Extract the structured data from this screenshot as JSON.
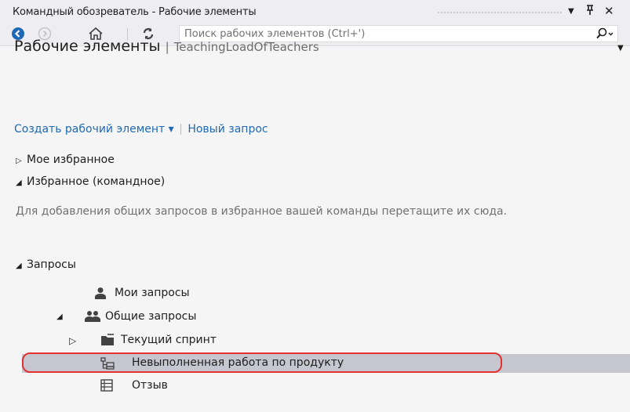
{
  "window": {
    "title": "Командный обозреватель - Рабочие элементы",
    "pin_glyph": "↕",
    "dropdown_glyph": "▼",
    "close_glyph": "✕"
  },
  "toolbar": {
    "search_placeholder": "Поиск рабочих элементов (Ctrl+')"
  },
  "header": {
    "title": "Рабочие элементы",
    "separator": "|",
    "project": "TeachingLoadOfTeachers"
  },
  "links": {
    "create": "Создать рабочий элемент ▾",
    "separator": "|",
    "new_query": "Новый запрос"
  },
  "sections": {
    "my_favorites": "Мое избранное",
    "team_favorites": "Избранное (командное)",
    "team_hint": "Для добавления общих запросов в избранное вашей команды перетащите их сюда.",
    "queries": "Запросы"
  },
  "tree": {
    "my_queries": "Мои запросы",
    "shared_queries": "Общие запросы",
    "current_sprint": "Текущий спринт",
    "product_backlog": "Невыполненная работа по продукту",
    "feedback": "Отзыв"
  },
  "colors": {
    "accent_link": "#1e68b5",
    "highlight_border": "#e53030",
    "selected_row": "#c6c6d0"
  }
}
